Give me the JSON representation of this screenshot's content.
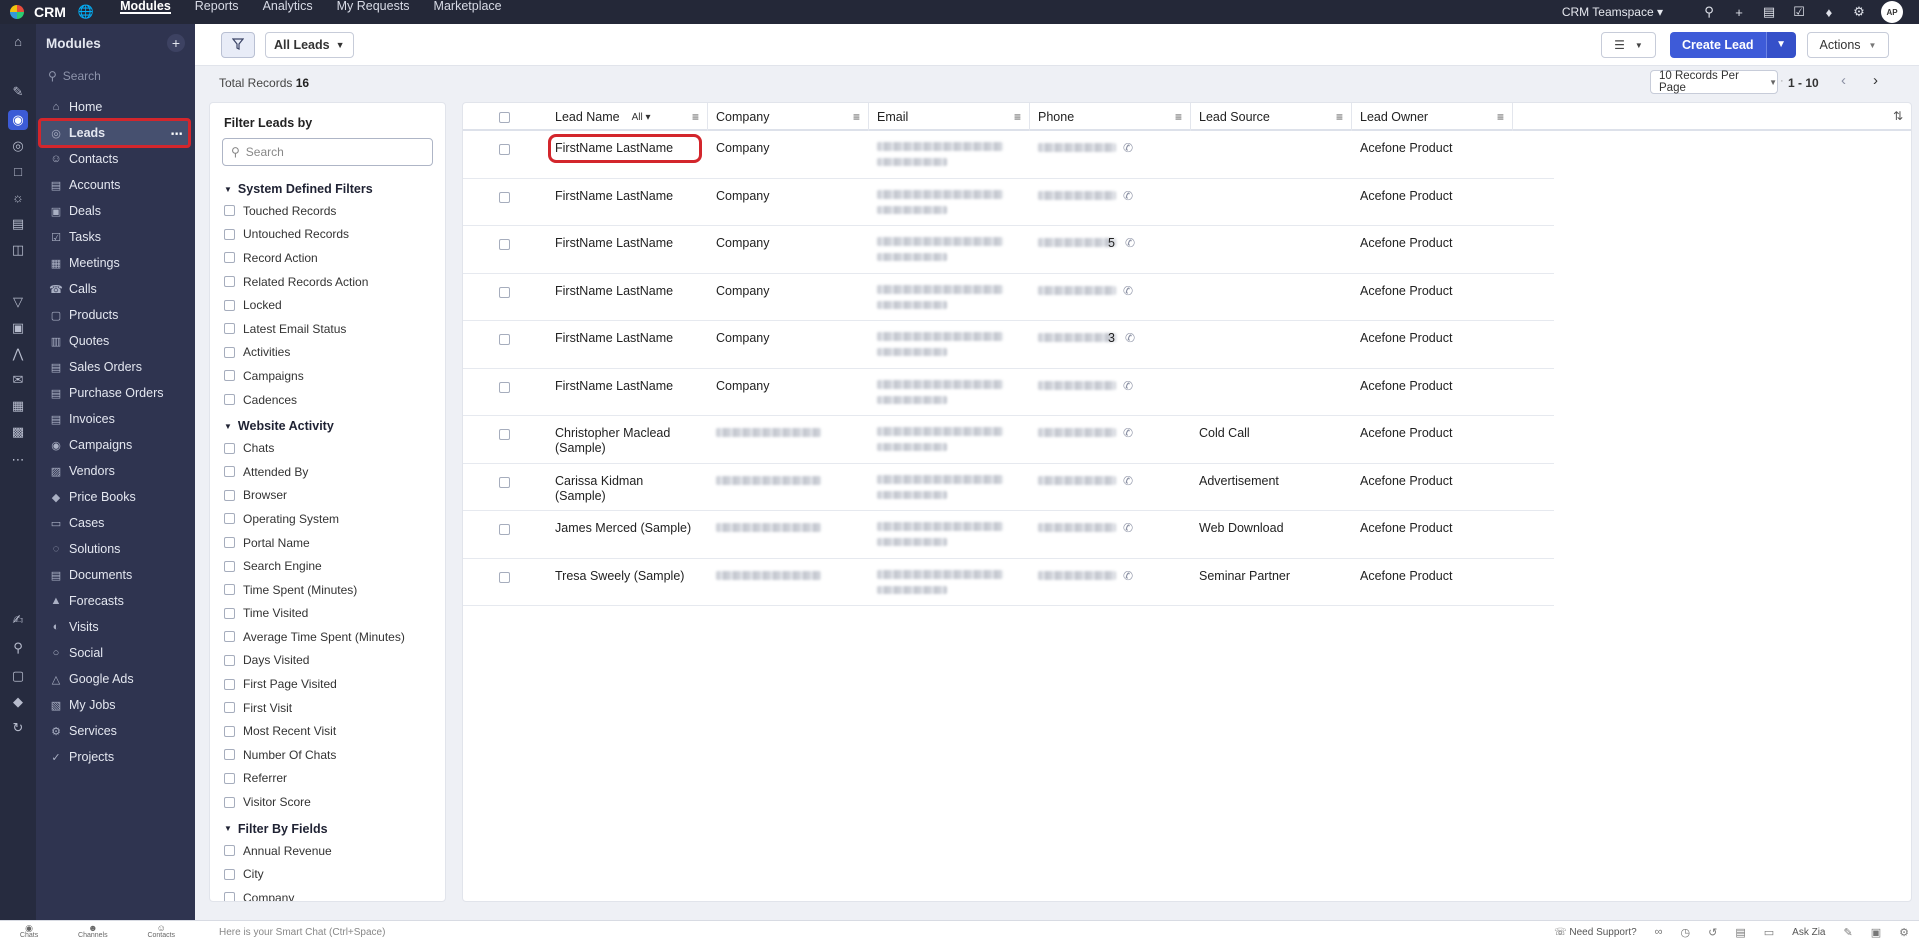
{
  "topbar": {
    "brand": "CRM",
    "nav": [
      "Modules",
      "Reports",
      "Analytics",
      "My Requests",
      "Marketplace"
    ],
    "active_nav": "Modules",
    "teamspace": "CRM Teamspace",
    "avatar": "AP"
  },
  "sidebar": {
    "title": "Modules",
    "search_placeholder": "Search",
    "items": [
      {
        "label": "Home",
        "icon": "home-icon"
      },
      {
        "label": "Leads",
        "icon": "leads-icon",
        "active": true
      },
      {
        "label": "Contacts",
        "icon": "contacts-icon"
      },
      {
        "label": "Accounts",
        "icon": "accounts-icon"
      },
      {
        "label": "Deals",
        "icon": "deals-icon"
      },
      {
        "label": "Tasks",
        "icon": "tasks-icon"
      },
      {
        "label": "Meetings",
        "icon": "meetings-icon"
      },
      {
        "label": "Calls",
        "icon": "calls-icon"
      },
      {
        "label": "Products",
        "icon": "products-icon"
      },
      {
        "label": "Quotes",
        "icon": "quotes-icon"
      },
      {
        "label": "Sales Orders",
        "icon": "sales-orders-icon"
      },
      {
        "label": "Purchase Orders",
        "icon": "purchase-orders-icon"
      },
      {
        "label": "Invoices",
        "icon": "invoices-icon"
      },
      {
        "label": "Campaigns",
        "icon": "campaigns-icon"
      },
      {
        "label": "Vendors",
        "icon": "vendors-icon"
      },
      {
        "label": "Price Books",
        "icon": "price-books-icon"
      },
      {
        "label": "Cases",
        "icon": "cases-icon"
      },
      {
        "label": "Solutions",
        "icon": "solutions-icon"
      },
      {
        "label": "Documents",
        "icon": "documents-icon"
      },
      {
        "label": "Forecasts",
        "icon": "forecasts-icon"
      },
      {
        "label": "Visits",
        "icon": "visits-icon"
      },
      {
        "label": "Social",
        "icon": "social-icon"
      },
      {
        "label": "Google Ads",
        "icon": "google-ads-icon"
      },
      {
        "label": "My Jobs",
        "icon": "my-jobs-icon"
      },
      {
        "label": "Services",
        "icon": "services-icon"
      },
      {
        "label": "Projects",
        "icon": "projects-icon"
      }
    ]
  },
  "toolbar": {
    "view": "All Leads",
    "create_label": "Create Lead",
    "actions_label": "Actions"
  },
  "subbar": {
    "total_label": "Total Records",
    "total_value": "16",
    "per_page": "10 Records Per Page",
    "range": "1 - 10"
  },
  "filters": {
    "title": "Filter Leads by",
    "search_placeholder": "Search",
    "sections": [
      {
        "title": "System Defined Filters",
        "items": [
          "Touched Records",
          "Untouched Records",
          "Record Action",
          "Related Records Action",
          "Locked",
          "Latest Email Status",
          "Activities",
          "Campaigns",
          "Cadences"
        ]
      },
      {
        "title": "Website Activity",
        "items": [
          "Chats",
          "Attended By",
          "Browser",
          "Operating System",
          "Portal Name",
          "Search Engine",
          "Time Spent (Minutes)",
          "Time Visited",
          "Average Time Spent (Minutes)",
          "Days Visited",
          "First Page Visited",
          "First Visit",
          "Most Recent Visit",
          "Number Of Chats",
          "Referrer",
          "Visitor Score"
        ]
      },
      {
        "title": "Filter By Fields",
        "items": [
          "Annual Revenue",
          "City",
          "Company"
        ]
      }
    ]
  },
  "table": {
    "columns": [
      "Lead Name",
      "Company",
      "Email",
      "Phone",
      "Lead Source",
      "Lead Owner"
    ],
    "lead_name_filter": "All",
    "rows": [
      {
        "name": "FirstName LastName",
        "company": "Company",
        "source": "",
        "owner": "Acefone Product",
        "highlight": true,
        "phone_suffix": ""
      },
      {
        "name": "FirstName LastName",
        "company": "Company",
        "source": "",
        "owner": "Acefone Product",
        "phone_suffix": ""
      },
      {
        "name": "FirstName LastName",
        "company": "Company",
        "source": "",
        "owner": "Acefone Product",
        "phone_suffix": "5"
      },
      {
        "name": "FirstName LastName",
        "company": "Company",
        "source": "",
        "owner": "Acefone Product",
        "phone_suffix": ""
      },
      {
        "name": "FirstName LastName",
        "company": "Company",
        "source": "",
        "owner": "Acefone Product",
        "phone_suffix": "3"
      },
      {
        "name": "FirstName LastName",
        "company": "Company",
        "source": "",
        "owner": "Acefone Product",
        "phone_suffix": ""
      },
      {
        "name": "Christopher Maclead (Sample)",
        "company": "",
        "source": "Cold Call",
        "owner": "Acefone Product",
        "phone_suffix": ""
      },
      {
        "name": "Carissa Kidman (Sample)",
        "company": "",
        "source": "Advertisement",
        "owner": "Acefone Product",
        "phone_suffix": ""
      },
      {
        "name": "James Merced (Sample)",
        "company": "",
        "source": "Web Download",
        "owner": "Acefone Product",
        "phone_suffix": ""
      },
      {
        "name": "Tresa Sweely (Sample)",
        "company": "",
        "source": "Seminar Partner",
        "owner": "Acefone Product",
        "phone_suffix": ""
      }
    ]
  },
  "bottombar": {
    "tabs": [
      "Chats",
      "Channels",
      "Contacts"
    ],
    "chat_placeholder": "Here is your Smart Chat (Ctrl+Space)",
    "support": "Need Support?",
    "zia": "Ask Zia"
  }
}
